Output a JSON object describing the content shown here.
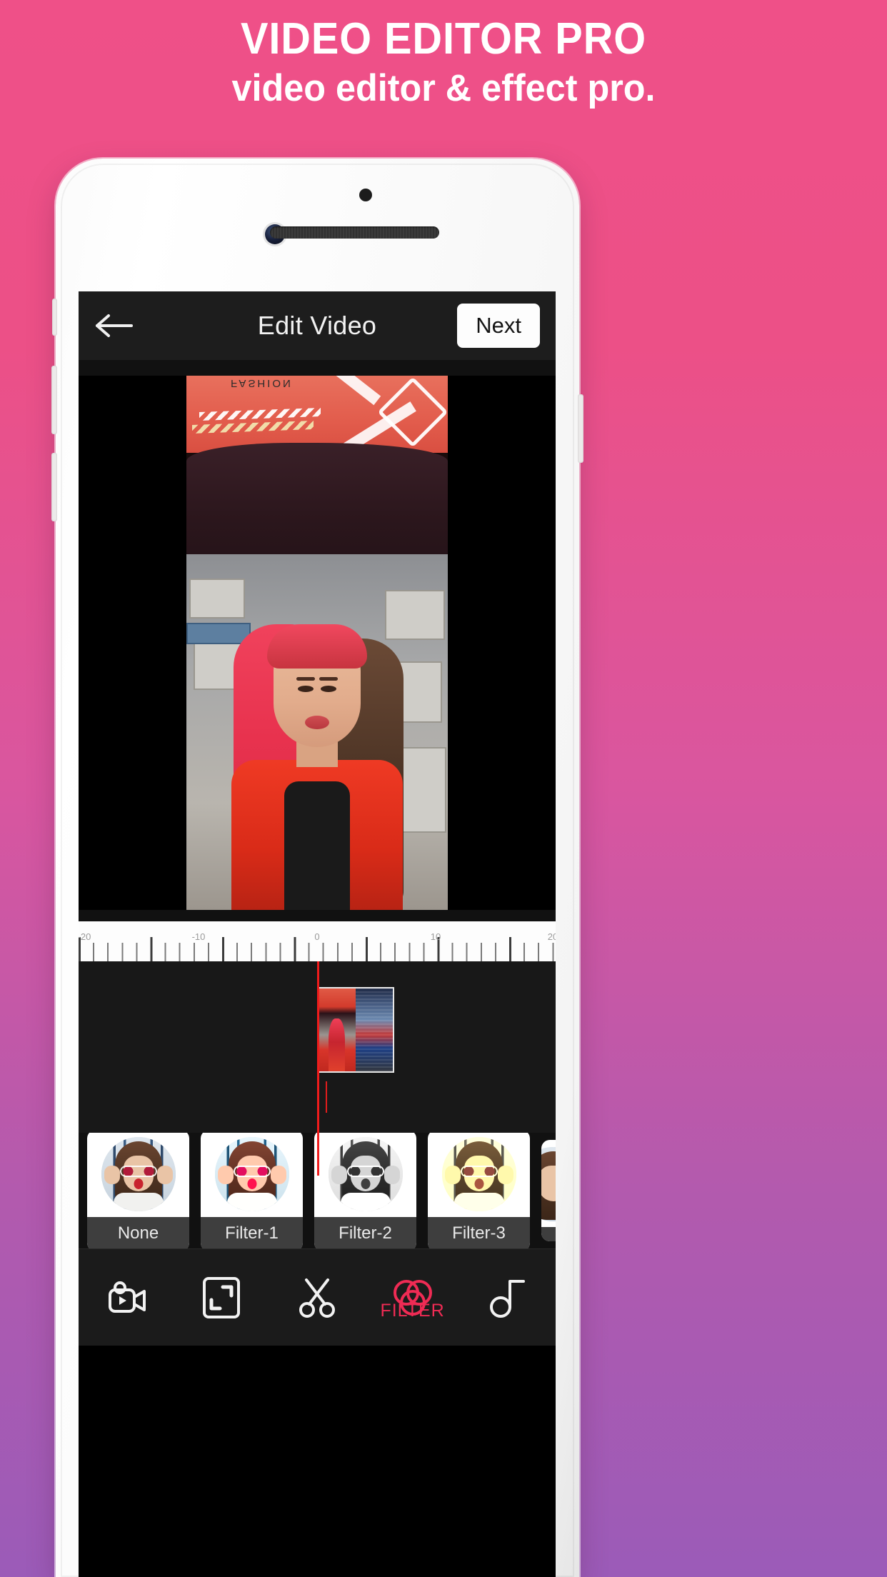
{
  "promo": {
    "title": "VIDEO EDITOR PRO",
    "subtitle": "video editor & effect pro."
  },
  "colors": {
    "gradient_top": "#ef5088",
    "gradient_bottom": "#9b5bb8",
    "accent_active": "#ef2b54",
    "appbar_bg": "#1d1d1d",
    "playhead": "#f01c1c"
  },
  "appbar": {
    "back_icon": "arrow-left-icon",
    "title": "Edit Video",
    "next_label": "Next"
  },
  "preview": {
    "banner_word": "FASHION"
  },
  "timeline": {
    "tick_labels": [
      "-20",
      "-10",
      "0",
      "10",
      "20"
    ],
    "playhead_position": "0"
  },
  "filters": [
    {
      "label": "None"
    },
    {
      "label": "Filter-1"
    },
    {
      "label": "Filter-2"
    },
    {
      "label": "Filter-3"
    },
    {
      "label": ""
    }
  ],
  "toolbar": [
    {
      "name": "video-camera-icon",
      "label": ""
    },
    {
      "name": "crop-frame-icon",
      "label": ""
    },
    {
      "name": "scissors-icon",
      "label": ""
    },
    {
      "name": "filter-circles-icon",
      "label": "FILTER"
    },
    {
      "name": "music-note-icon",
      "label": ""
    }
  ]
}
